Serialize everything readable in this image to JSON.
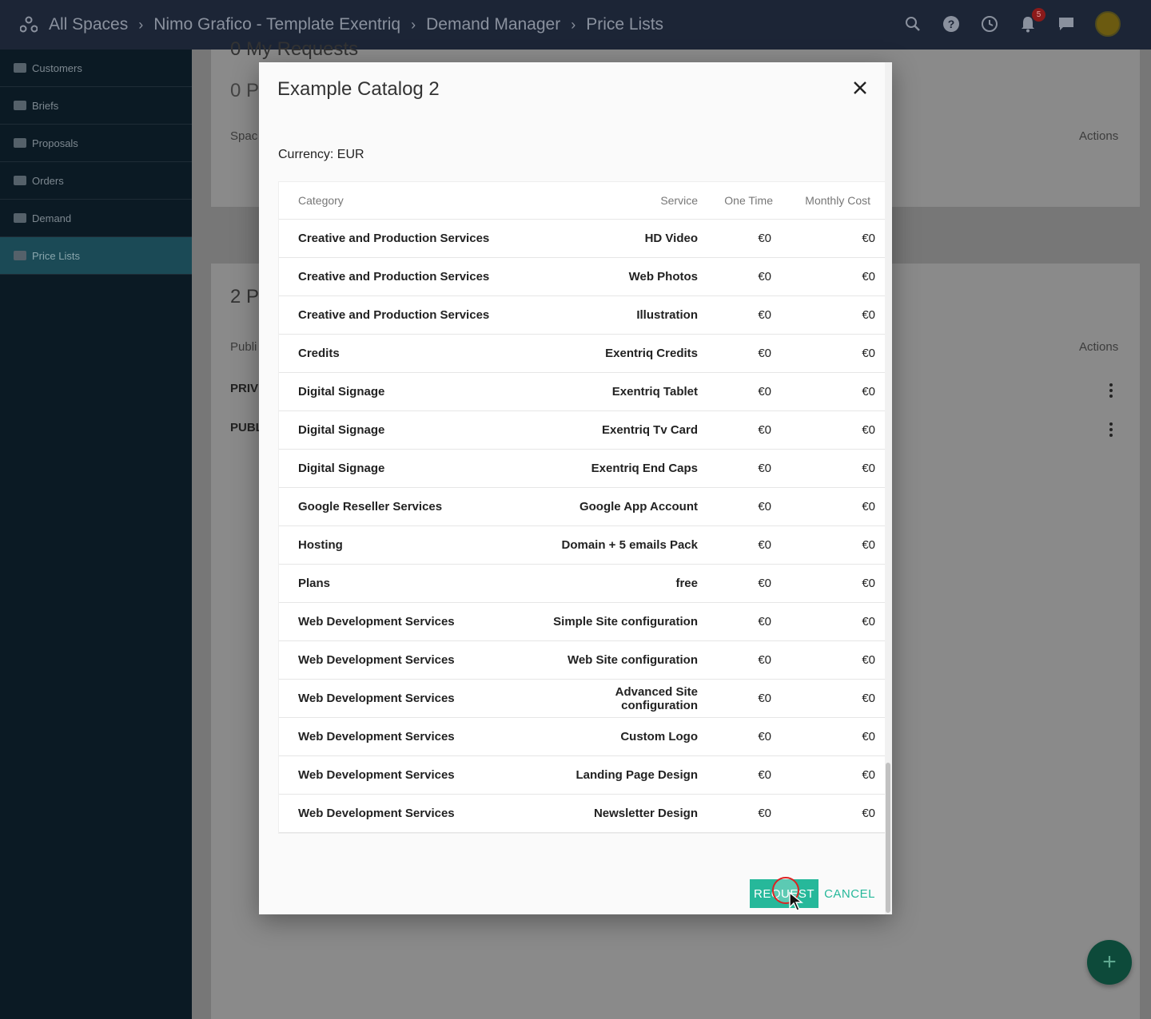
{
  "topbar": {
    "breadcrumbs": [
      "All Spaces",
      "Nimo Grafico - Template Exentriq",
      "Demand Manager",
      "Price Lists"
    ],
    "notification_count": "5"
  },
  "sidebar": {
    "items": [
      {
        "label": "Customers"
      },
      {
        "label": "Briefs"
      },
      {
        "label": "Proposals"
      },
      {
        "label": "Orders"
      },
      {
        "label": "Demand"
      },
      {
        "label": "Price Lists"
      }
    ]
  },
  "background": {
    "requests_title": "0 My Requests",
    "requests_filter": "0 P",
    "requests_col_space": "Spac",
    "requests_col_actions": "Actions",
    "pricelists_title": "2 P",
    "pricelists_col_public": "Publi",
    "pricelists_col_actions": "Actions",
    "row1": "PRIV",
    "row2": "PUBL"
  },
  "modal": {
    "title": "Example Catalog 2",
    "currency": "Currency: EUR",
    "columns": {
      "category": "Category",
      "service": "Service",
      "one_time": "One Time",
      "monthly": "Monthly Cost"
    },
    "rows": [
      {
        "category": "Creative and Production Services",
        "service": "HD Video",
        "one_time": "€0",
        "monthly": "€0"
      },
      {
        "category": "Creative and Production Services",
        "service": "Web Photos",
        "one_time": "€0",
        "monthly": "€0"
      },
      {
        "category": "Creative and Production Services",
        "service": "Illustration",
        "one_time": "€0",
        "monthly": "€0"
      },
      {
        "category": "Credits",
        "service": "Exentriq Credits",
        "one_time": "€0",
        "monthly": "€0"
      },
      {
        "category": "Digital Signage",
        "service": "Exentriq Tablet",
        "one_time": "€0",
        "monthly": "€0"
      },
      {
        "category": "Digital Signage",
        "service": "Exentriq Tv Card",
        "one_time": "€0",
        "monthly": "€0"
      },
      {
        "category": "Digital Signage",
        "service": "Exentriq End Caps",
        "one_time": "€0",
        "monthly": "€0"
      },
      {
        "category": "Google Reseller Services",
        "service": "Google App Account",
        "one_time": "€0",
        "monthly": "€0"
      },
      {
        "category": "Hosting",
        "service": "Domain + 5 emails Pack",
        "one_time": "€0",
        "monthly": "€0"
      },
      {
        "category": "Plans",
        "service": "free",
        "one_time": "€0",
        "monthly": "€0"
      },
      {
        "category": "Web Development Services",
        "service": "Simple Site configuration",
        "one_time": "€0",
        "monthly": "€0"
      },
      {
        "category": "Web Development Services",
        "service": "Web Site configuration",
        "one_time": "€0",
        "monthly": "€0"
      },
      {
        "category": "Web Development Services",
        "service": "Advanced Site configuration",
        "one_time": "€0",
        "monthly": "€0"
      },
      {
        "category": "Web Development Services",
        "service": "Custom Logo",
        "one_time": "€0",
        "monthly": "€0"
      },
      {
        "category": "Web Development Services",
        "service": "Landing Page Design",
        "one_time": "€0",
        "monthly": "€0"
      },
      {
        "category": "Web Development Services",
        "service": "Newsletter Design",
        "one_time": "€0",
        "monthly": "€0"
      }
    ],
    "request_label": "REQUEST",
    "cancel_label": "CANCEL"
  },
  "colors": {
    "topbar": "#1c2536",
    "sidebar": "#0b1a24",
    "accent": "#26b89a"
  }
}
